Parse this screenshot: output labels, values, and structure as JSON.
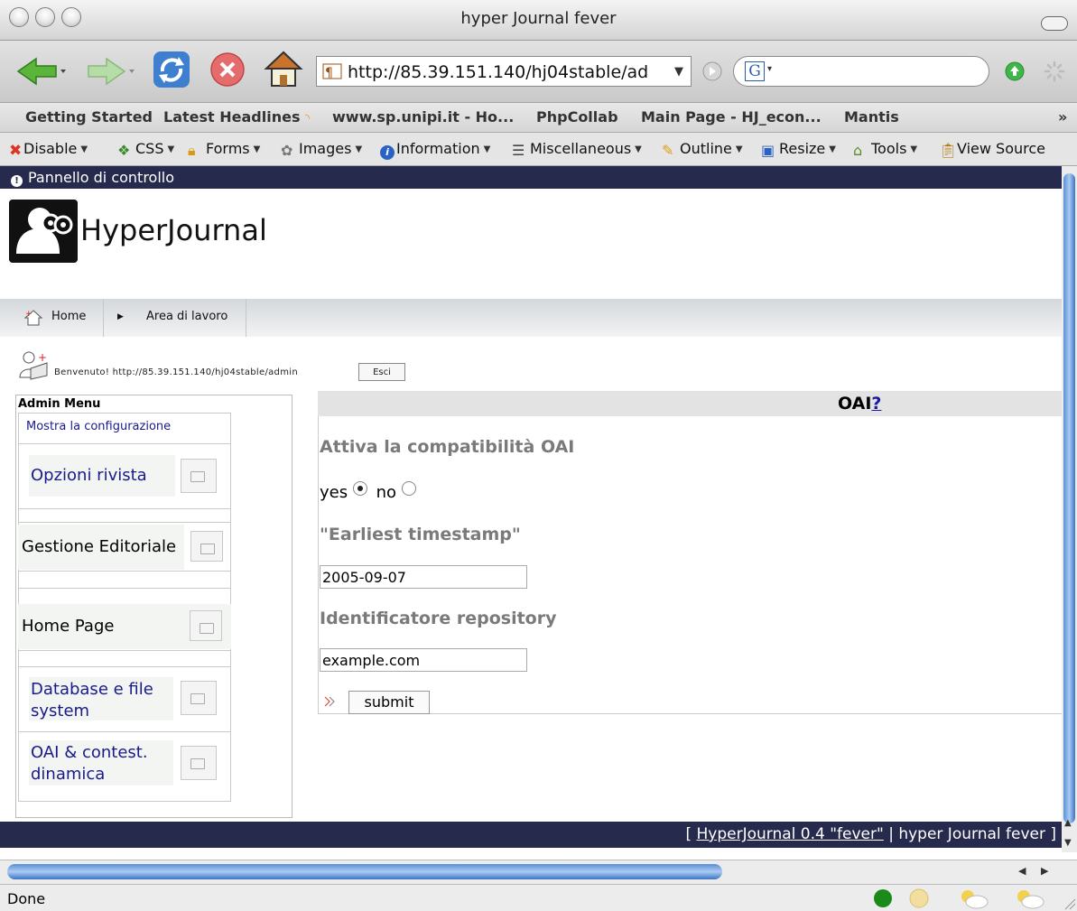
{
  "window": {
    "title": "hyper Journal fever"
  },
  "nav": {
    "url": "http://85.39.151.140/hj04stable/ad",
    "search_engine_letter": "G"
  },
  "bookmarks": [
    "Getting Started",
    "Latest Headlines",
    "www.sp.unipi.it - Ho...",
    "PhpCollab",
    "Main Page - HJ_econ...",
    "Mantis"
  ],
  "bookmarks_overflow": "»",
  "devbar": [
    "Disable",
    "CSS",
    "Forms",
    "Images",
    "Information",
    "Miscellaneous",
    "Outline",
    "Resize",
    "Tools",
    "View Source"
  ],
  "page": {
    "panel_title": "Pannello di controllo",
    "brand": "HyperJournal",
    "breadcrumb": {
      "home": "Home",
      "area": "Area di lavoro"
    },
    "welcome": "Benvenuto! http://85.39.151.140/hj04stable/admin",
    "logout": "Esci",
    "admin_menu": {
      "title": "Admin Menu",
      "show_config": "Mostra la configurazione",
      "items": [
        "Opzioni rivista",
        "Gestione Editoriale",
        "Home Page",
        "Database e file system",
        "OAI & contest. dinamica"
      ]
    },
    "oai": {
      "title": "OAI",
      "help": "?",
      "enable_label": "Attiva la compatibilità OAI",
      "yes": "yes",
      "no": "no",
      "selected": "yes",
      "earliest_label": "\"Earliest timestamp\"",
      "earliest_value": "2005-09-07",
      "repo_label": "Identificatore repository",
      "repo_value": "example.com",
      "submit": "submit"
    },
    "footer": {
      "open": "[ ",
      "link": "HyperJournal 0.4 \"fever\"",
      "rest": " | hyper Journal fever ]"
    }
  },
  "status": {
    "text": "Done"
  }
}
